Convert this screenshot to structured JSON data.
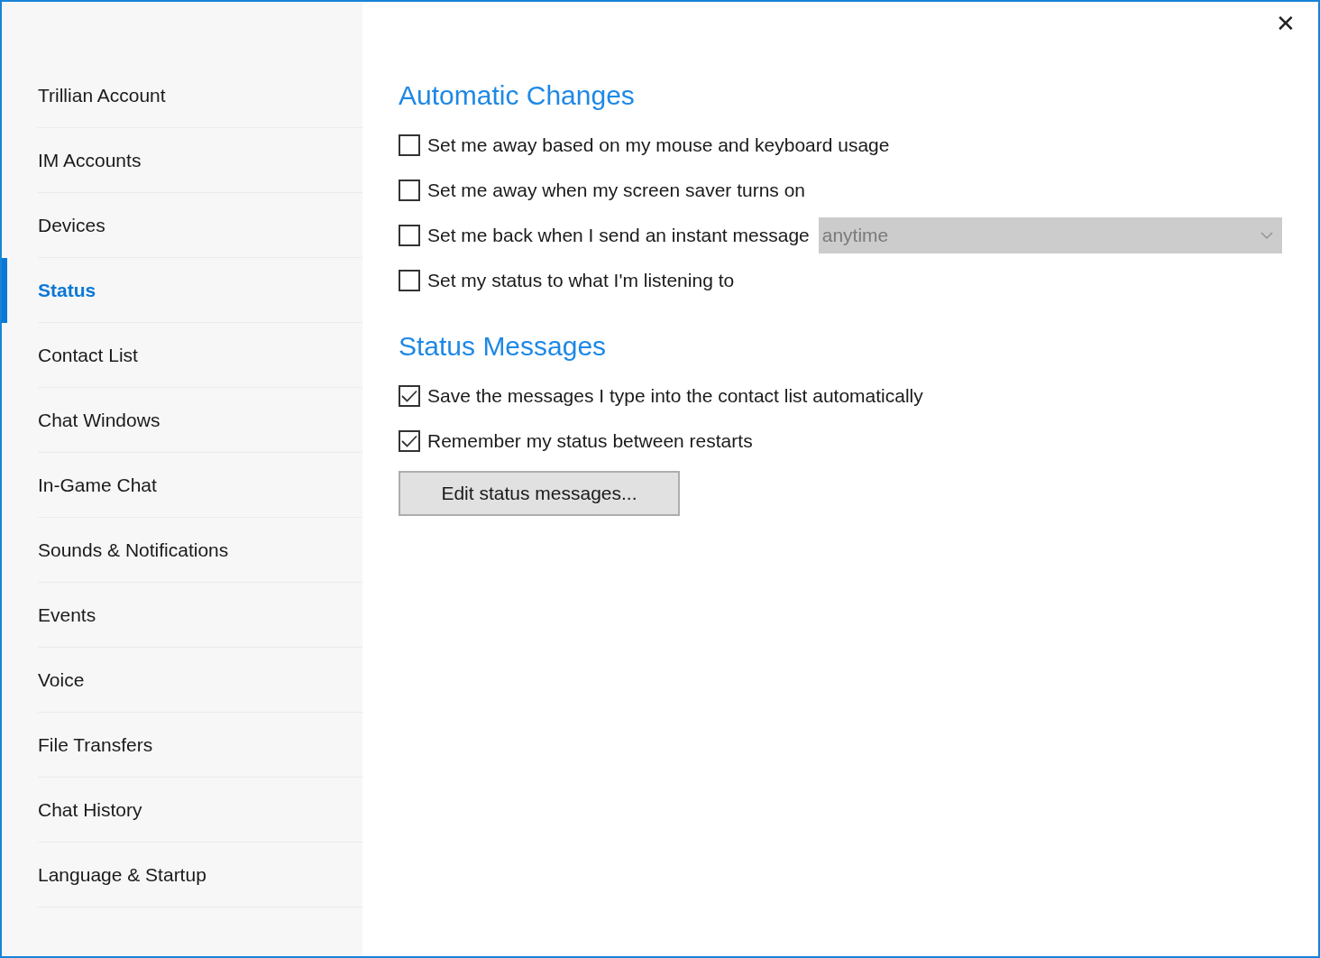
{
  "close_button": {
    "label": "✕"
  },
  "sidebar": {
    "items": [
      {
        "label": "Trillian Account",
        "selected": false
      },
      {
        "label": "IM Accounts",
        "selected": false
      },
      {
        "label": "Devices",
        "selected": false
      },
      {
        "label": "Status",
        "selected": true
      },
      {
        "label": "Contact List",
        "selected": false
      },
      {
        "label": "Chat Windows",
        "selected": false
      },
      {
        "label": "In-Game Chat",
        "selected": false
      },
      {
        "label": "Sounds & Notifications",
        "selected": false
      },
      {
        "label": "Events",
        "selected": false
      },
      {
        "label": "Voice",
        "selected": false
      },
      {
        "label": "File Transfers",
        "selected": false
      },
      {
        "label": "Chat History",
        "selected": false
      },
      {
        "label": "Language & Startup",
        "selected": false
      }
    ]
  },
  "sections": [
    {
      "title": "Automatic Changes",
      "options": [
        {
          "label": "Set me away based on my mouse and keyboard usage",
          "checked": false
        },
        {
          "label": "Set me away when my screen saver turns on",
          "checked": false
        },
        {
          "label": "Set me back when I send an instant message",
          "checked": false,
          "dropdown": {
            "value": "anytime",
            "disabled": true
          }
        },
        {
          "label": "Set my status to what I'm listening to",
          "checked": false
        }
      ]
    },
    {
      "title": "Status Messages",
      "options": [
        {
          "label": "Save the messages I type into the contact list automatically",
          "checked": true
        },
        {
          "label": "Remember my status between restarts",
          "checked": true
        }
      ],
      "button": "Edit status messages..."
    }
  ]
}
